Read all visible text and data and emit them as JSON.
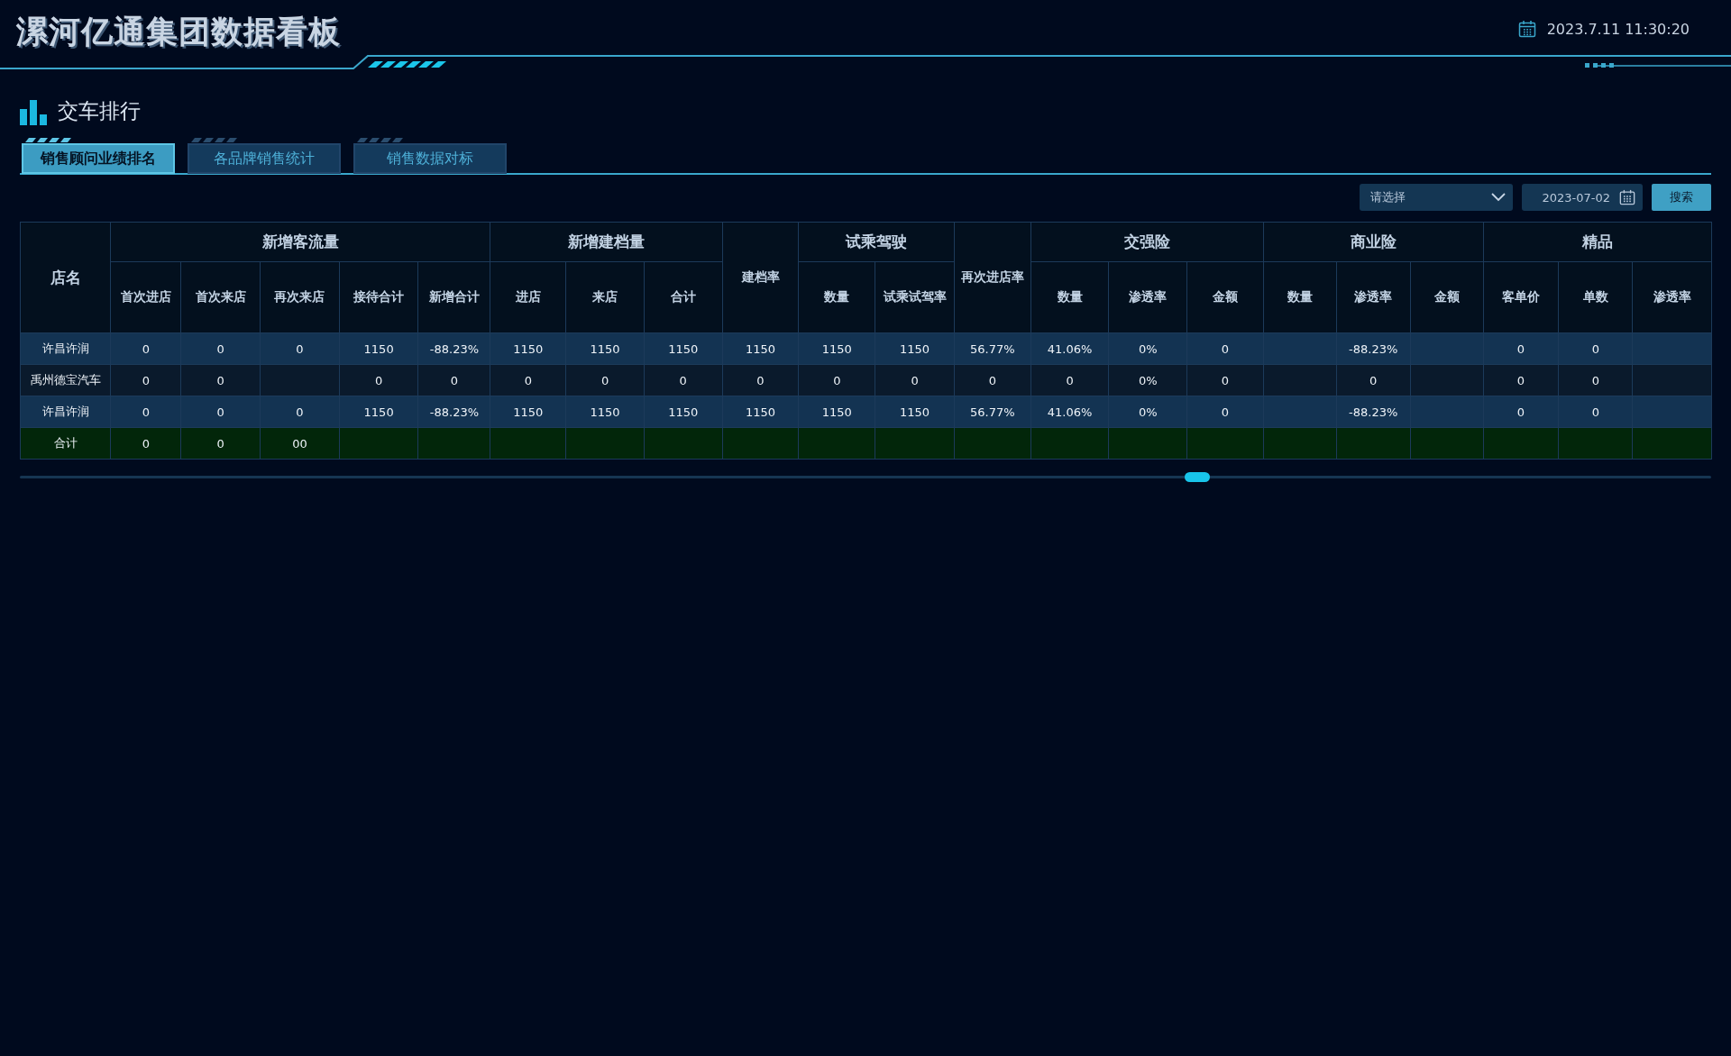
{
  "header": {
    "title": "漯河亿通集团数据看板",
    "datetime": "2023.7.11 11:30:20"
  },
  "section": {
    "title": "交车排行"
  },
  "tabs": [
    {
      "label": "销售顾问业绩排名",
      "selected": true
    },
    {
      "label": "各品牌销售统计",
      "selected": false
    },
    {
      "label": "销售数据对标",
      "selected": false
    }
  ],
  "filters": {
    "select": {
      "placeholder": "请选择"
    },
    "date": {
      "value": "2023-07-02"
    },
    "search_button": "搜索"
  },
  "table": {
    "groups": [
      {
        "label": "店名"
      },
      {
        "label": "新增客流量",
        "columns": [
          "首次进店",
          "首次来店",
          "再次来店",
          "接待合计",
          "新增合计"
        ]
      },
      {
        "label": "新增建档量",
        "columns": [
          "进店",
          "来店",
          "合计"
        ]
      },
      {
        "label": "建档率"
      },
      {
        "label": "试乘驾驶",
        "columns": [
          "数量",
          "试乘试驾率"
        ]
      },
      {
        "label": "再次进店率"
      },
      {
        "label": "交强险",
        "columns": [
          "数量",
          "渗透率",
          "金额"
        ]
      },
      {
        "label": "商业险",
        "columns": [
          "数量",
          "渗透率",
          "金额"
        ]
      },
      {
        "label": "精品",
        "columns": [
          "客单价",
          "单数",
          "渗透率"
        ]
      }
    ],
    "rows": [
      {
        "kind": "data",
        "cells": [
          "许昌许润",
          "0",
          "0",
          "0",
          "1150",
          "-88.23%",
          "1150",
          "1150",
          "1150",
          "1150",
          "1150",
          "1150",
          "56.77%",
          "41.06%",
          "0%",
          "0",
          null,
          "-88.23%",
          null,
          "0",
          "0",
          null
        ]
      },
      {
        "kind": "data",
        "cells": [
          "禹州德宝汽车",
          "0",
          "0",
          null,
          "0",
          "0",
          "0",
          "0",
          "0",
          "0",
          "0",
          "0",
          "0",
          "0",
          "0%",
          "0",
          null,
          "0",
          null,
          "0",
          "0",
          null
        ]
      },
      {
        "kind": "data",
        "cells": [
          "许昌许润",
          "0",
          "0",
          "0",
          "1150",
          "-88.23%",
          "1150",
          "1150",
          "1150",
          "1150",
          "1150",
          "1150",
          "56.77%",
          "41.06%",
          "0%",
          "0",
          null,
          "-88.23%",
          null,
          "0",
          "0",
          null
        ]
      },
      {
        "kind": "total",
        "cells": [
          "合计",
          "0",
          "0",
          "00"
        ]
      }
    ]
  }
}
